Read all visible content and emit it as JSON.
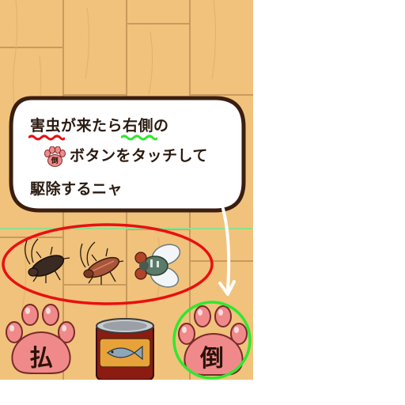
{
  "tutorial": {
    "line1": {
      "part_a": "害虫",
      "part_b": "が来たら",
      "part_c": "右側",
      "part_d": "の"
    },
    "line2_text": "ボタンをタッチして",
    "line2_icon_label": "倒",
    "line3": "駆除するニャ"
  },
  "bugs": [
    {
      "name": "cockroach-dark"
    },
    {
      "name": "cockroach-brown"
    },
    {
      "name": "fly"
    }
  ],
  "buttons": {
    "left_label": "払",
    "right_label": "倒"
  },
  "colors": {
    "paw_pink": "#f08a8a",
    "highlight_red": "#e81010",
    "highlight_green": "#2ee82e",
    "floor": "#f0c27c"
  }
}
